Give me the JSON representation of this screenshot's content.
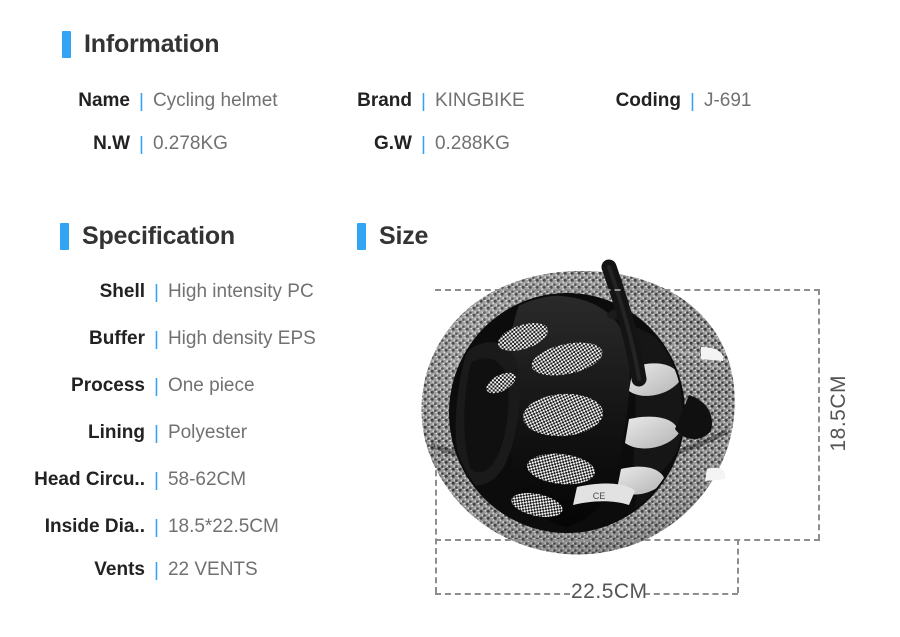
{
  "sections": {
    "information": {
      "title": "Information"
    },
    "specification": {
      "title": "Specification"
    },
    "size": {
      "title": "Size"
    }
  },
  "separator": "|",
  "accent_color": "#33a3f4",
  "information": {
    "rows": [
      {
        "label": "Name",
        "value": "Cycling helmet"
      },
      {
        "label": "N.W",
        "value": "0.278KG"
      },
      {
        "label": "Brand",
        "value": "KINGBIKE"
      },
      {
        "label": "G.W",
        "value": "0.288KG"
      },
      {
        "label": "Coding",
        "value": "J-691"
      }
    ]
  },
  "specification": {
    "rows": [
      {
        "label": "Shell",
        "value": "High intensity PC"
      },
      {
        "label": "Buffer",
        "value": "High density EPS"
      },
      {
        "label": "Process",
        "value": "One piece"
      },
      {
        "label": "Lining",
        "value": "Polyester"
      },
      {
        "label": "Head Circu..",
        "value": "58-62CM"
      },
      {
        "label": "Inside Dia..",
        "value": "18.5*22.5CM"
      },
      {
        "label": "Vents",
        "value": "22 VENTS"
      }
    ]
  },
  "size": {
    "height_label": "18.5CM",
    "width_label": "22.5CM",
    "product_image_alt": "cycling-helmet-inside-view"
  }
}
